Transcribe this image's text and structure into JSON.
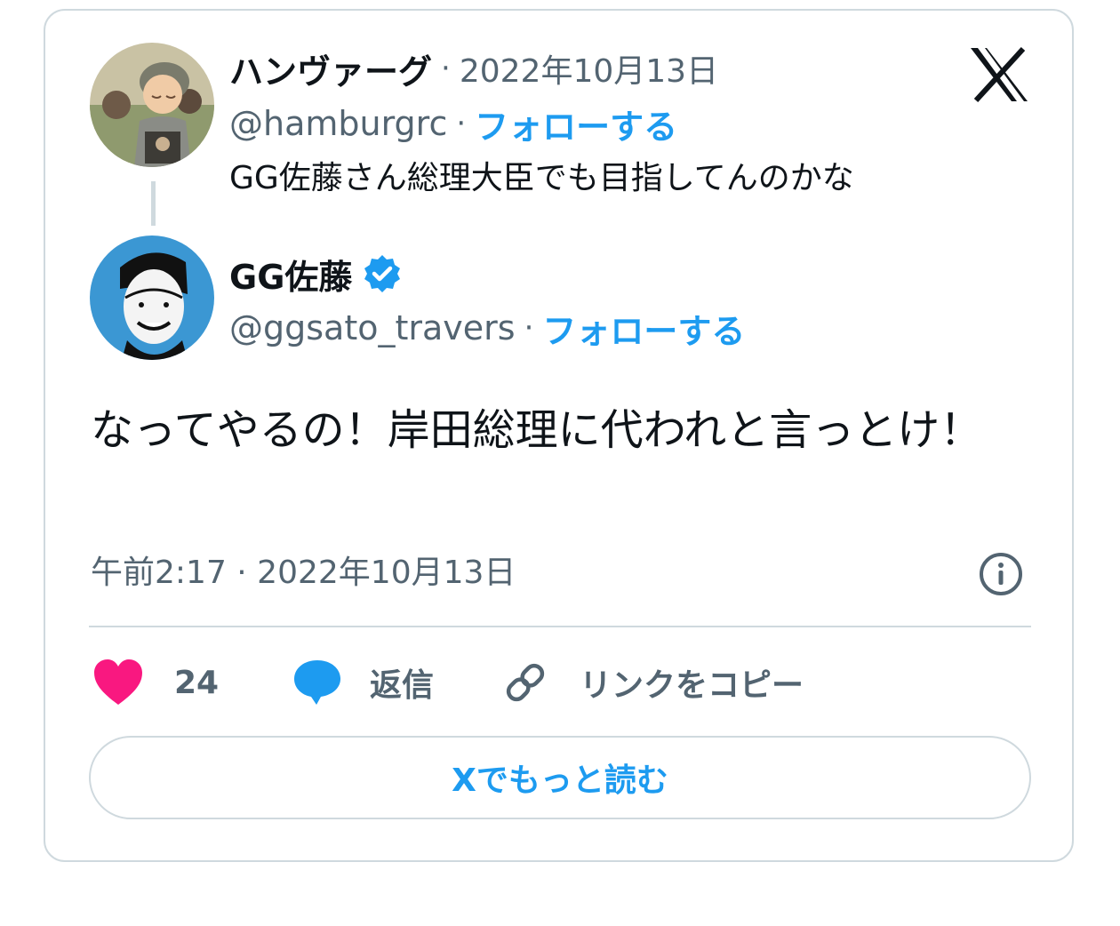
{
  "reply_to": {
    "display_name": "ハンヴァーグ",
    "date": "2022年10月13日",
    "handle": "@hamburgrc",
    "follow_label": "フォローする",
    "text": "GG佐藤さん総理大臣でも目指してんのかな",
    "separator": "·"
  },
  "tweet": {
    "display_name": "GG佐藤",
    "handle": "@ggsato_travers",
    "follow_label": "フォローする",
    "separator": "·",
    "text": "なってやるの！岸田総理に代われと言っとけ！",
    "timestamp": "午前2:17 · 2022年10月13日"
  },
  "actions": {
    "like_count": "24",
    "reply_label": "返信",
    "copy_link_label": "リンクをコピー"
  },
  "read_more_label": "Xでもっと読む",
  "icons": {
    "brand": "x-logo-icon",
    "verified": "verified-badge-icon",
    "info": "info-icon",
    "like": "heart-icon",
    "reply": "speech-bubble-icon",
    "link": "link-icon"
  },
  "colors": {
    "accent": "#1d9bf0",
    "heart": "#f91880",
    "text": "#0f1419",
    "muted": "#536471",
    "border": "#cfd9de"
  }
}
